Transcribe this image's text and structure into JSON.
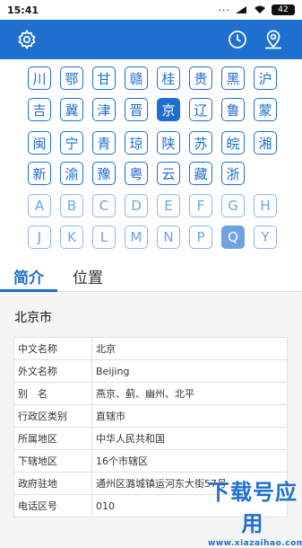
{
  "status_bar": {
    "time": "15:41",
    "signal_dots": "···",
    "battery": "42"
  },
  "header": {
    "settings_icon": "gear-icon",
    "history_icon": "clock-icon",
    "location_icon": "location-pin-icon"
  },
  "provinces": [
    [
      "川",
      "鄂",
      "甘",
      "赣",
      "桂",
      "贵",
      "黑",
      "沪"
    ],
    [
      "吉",
      "冀",
      "津",
      "晋",
      "京",
      "辽",
      "鲁",
      "蒙"
    ],
    [
      "闽",
      "宁",
      "青",
      "琼",
      "陕",
      "苏",
      "皖",
      "湘"
    ],
    [
      "新",
      "渝",
      "豫",
      "粤",
      "云",
      "藏",
      "浙"
    ]
  ],
  "selected_province": "京",
  "letters": [
    [
      "A",
      "B",
      "C",
      "D",
      "E",
      "F",
      "G",
      "H"
    ],
    [
      "J",
      "K",
      "L",
      "M",
      "N",
      "P",
      "Q",
      "Y"
    ]
  ],
  "selected_letter": "Q",
  "tabs": [
    "简介",
    "位置"
  ],
  "active_tab": "简介",
  "content": {
    "title": "北京市",
    "rows": [
      {
        "key": "中文名称",
        "value": "北京"
      },
      {
        "key": "外文名称",
        "value": "Beijing"
      },
      {
        "key": "别　名",
        "value": "燕京、蓟、幽州、北平"
      },
      {
        "key": "行政区类别",
        "value": "直辖市"
      },
      {
        "key": "所属地区",
        "value": "中华人民共和国"
      },
      {
        "key": "下辖地区",
        "value": "16个市辖区"
      },
      {
        "key": "政府驻地",
        "value": "通州区潞城镇运河东大街57号"
      },
      {
        "key": "电话区号",
        "value": "010"
      }
    ]
  },
  "watermark": {
    "main": "下载号应用",
    "sub": "www.xiazaihao.com"
  },
  "colors": {
    "primary": "#1f6fcf",
    "light_primary": "#6ea2e5"
  }
}
